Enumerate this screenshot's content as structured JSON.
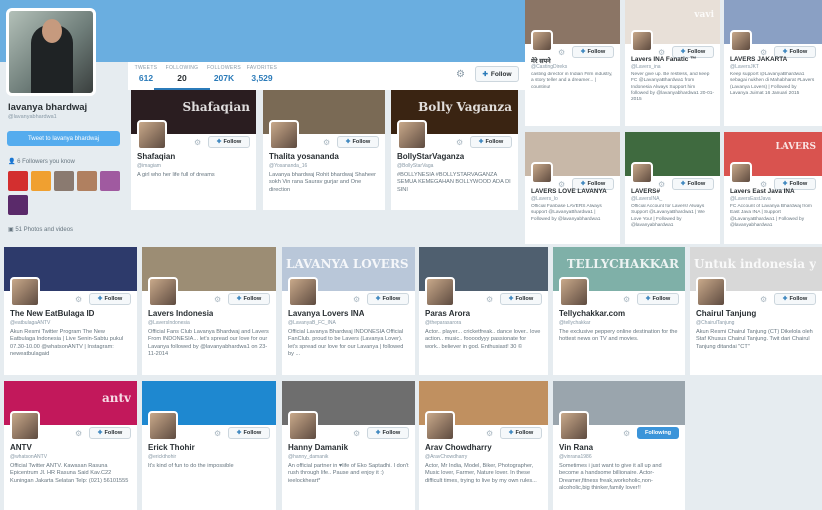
{
  "profile": {
    "name": "lavanya bhardwaj",
    "handle": "@lavanyabhardwa1",
    "tweet_to_label": "Tweet to lavanya bhardwaj",
    "followers_you_know": "6 Followers you know",
    "photos_videos": "51 Photos and videos"
  },
  "stats": [
    {
      "label": "TWEETS",
      "value": "612"
    },
    {
      "label": "FOLLOWING",
      "value": "20"
    },
    {
      "label": "FOLLOWERS",
      "value": "207K"
    },
    {
      "label": "FAVORITES",
      "value": "3,529"
    }
  ],
  "follow_label": "Follow",
  "following_label": "Following",
  "cards": [
    {
      "name": "Shafaqian",
      "handle": "@imagiam",
      "bio": "A girl who her life full of dreams",
      "button": "Follow",
      "banner": "#2a1d20",
      "banner_text": "Shafaqian"
    },
    {
      "name": "Thalita yosananda",
      "handle": "@Yosananda_16",
      "bio": "Lavanya bhardwaj Rohit bhardwaj Shaheer sokh Vin rana Saurav gurjar and One direction",
      "button": "Follow",
      "banner": "#7a6a55"
    },
    {
      "name": "BollyStarVaganza",
      "handle": "@BollyStarVaga",
      "bio": "#BOLLYNESIA #BOLLYSTARVAGANZA SEMUA KEMEGAHAN BOLLYWOOD ADA DI SINI",
      "button": "Follow",
      "banner": "#3a2412",
      "banner_text": "Bolly Vaganza"
    },
    {
      "name": "मेरे सपने",
      "handle": "@CastingDireks",
      "bio": "casting director in Indian Film industry, a story teller and a dreamer... | countinu!",
      "button": "Follow",
      "banner": "#8b7565"
    },
    {
      "name": "Lavers INA Fanatic ™",
      "handle": "@Lavers_ina",
      "bio": "Never give up. Be restless, and keep FC @LavanyaBhardwa1 from Indonesia Always Support him followed by @lavanyabhardwa1 20-01-2015",
      "button": "Follow",
      "banner": "#e8e0d8",
      "banner_text": "vavi"
    },
    {
      "name": "LAVERS JAKARTA",
      "handle": "@LaversJKT",
      "bio": "Keep support @LavanyaBhardwa1 sebagai nukhen di Mahabharat #Lavers (Lavanya Lovers) | Followed by Lavanya Juimat 16 Januari 2015",
      "button": "Follow",
      "banner": "#8aa0c4"
    },
    {
      "name": "LAVERS LOVE LAVANYA",
      "handle": "@Lavers_lo",
      "bio": "Official Fanbase LAVERS Always support @LavanyaBhardwa1 | Followed by @lavanyabhardwa1",
      "button": "Follow",
      "banner": "#c8b8a8"
    },
    {
      "name": "LAVERS#",
      "handle": "@LaversINA_",
      "bio": "Official Account for Lavers! Always Support @LavanyaBhardwa1 | We Love You! | Followed by @lavanyabhardwa1",
      "button": "Follow",
      "banner": "#3f6a3f"
    },
    {
      "name": "Lavers East Java INA",
      "handle": "@LaversEastJava",
      "bio": "FC Account of Lavanya Bhardwaj from East Java INA | Support @LavanyaBhardwa1 | Followed by @lavanyabhardwa1",
      "button": "Follow",
      "banner": "#d9534f",
      "banner_text": "LAVERS"
    },
    {
      "name": "The New EatBulaga ID",
      "handle": "@eatbulagaANTV",
      "bio": "Akun Resmi Twitter Program The New Eatbulaga Indonesia | Live Senin-Sabtu pukul 07.30-10.00 @whatsonANTV | Instagram: neweatbulagaid",
      "button": "Follow",
      "banner": "#2d3a6b"
    },
    {
      "name": "Lavers Indonesia",
      "handle": "@LaversIndonesia",
      "bio": "Official Fans Club Lavanya Bhardwaj and Lavers From INDONESIA... let's spread our love for our Lavanya followed by @lavanyabhardwa1 on 23-11-2014",
      "button": "Follow",
      "banner": "#9c8d74"
    },
    {
      "name": "Lavanya Lovers INA",
      "handle": "@LavanyaB_FC_INA",
      "bio": "Official Lavanya Bhardwaj INDONESIA Official FanClub. proud to be Lavers (Lavanya Lover). let's spread our love for our Lavanya | followed by ...",
      "button": "Follow",
      "banner": "#b9c7d9",
      "banner_text": "LAVANYA LOVERS INA"
    },
    {
      "name": "Paras Arora",
      "handle": "@theparasarora",
      "bio": "Actor.. player... cricketfreak.. dance lover.. love action.. music.. foooodyyy passionate for work.. believer in god. Enthusiast! 30 ©",
      "button": "Follow",
      "banner": "#4f5f6f"
    },
    {
      "name": "Tellychakkar.com",
      "handle": "@tellychakkar",
      "bio": "The exclusive peppery online destination for the hottest news on TV and movies.",
      "button": "Follow",
      "banner": "#7fb0a8",
      "banner_text": "TELLYCHAKKAR"
    },
    {
      "name": "Chairul Tanjung",
      "handle": "@ChairulTanjung",
      "bio": "Akun Resmi Chairul Tanjung (CT) Dikelola oleh Staf Khusus Chairul Tanjung. Twit dari Chairul Tanjung ditandai \"CT\"",
      "button": "Follow",
      "banner": "#d8d8d8",
      "banner_text": "Untuk indonesia yang lebih baik"
    },
    {
      "name": "ANTV",
      "handle": "@whatsonANTV",
      "bio": "Official Twitter ANTV. Kawasan Rasuna Epicentrum Jl. HR Rasuna Said Kav.C22 Kuningan Jakarta Selatan Telp: (021) 56101555",
      "button": "Follow",
      "banner": "#c2185b",
      "banner_text": "antv"
    },
    {
      "name": "Erick Thohir",
      "handle": "@erickthohir",
      "bio": "It's kind of fun to do the impossible",
      "button": "Follow",
      "banner": "#1e88d0"
    },
    {
      "name": "Hanny Damanik",
      "handle": "@hanny_damanik",
      "bio": "An official partner in ♥life of Eko Saptadhi. I don't rush through life.. Pause and enjoy it :) ieelockheart*",
      "button": "Follow",
      "banner": "#6e6e6e"
    },
    {
      "name": "Arav Chowdharry",
      "handle": "@AravChowdharry",
      "bio": "Actor, Mr India, Model, Biker, Photographer, Music lover, Farmer, Nature lover. In these difficult times, trying to live by my own rules...",
      "button": "Follow",
      "banner": "#c09060"
    },
    {
      "name": "Vin Rana",
      "handle": "@vinrana1986",
      "bio": "Sometimes i just want to give it all up and become a handsome billionaire. Actor-Dreamer,fitness freak,workoholic,non-alcoholic,big thinker,family lover!!",
      "button": "Following",
      "banner": "#9aa5ad"
    }
  ]
}
